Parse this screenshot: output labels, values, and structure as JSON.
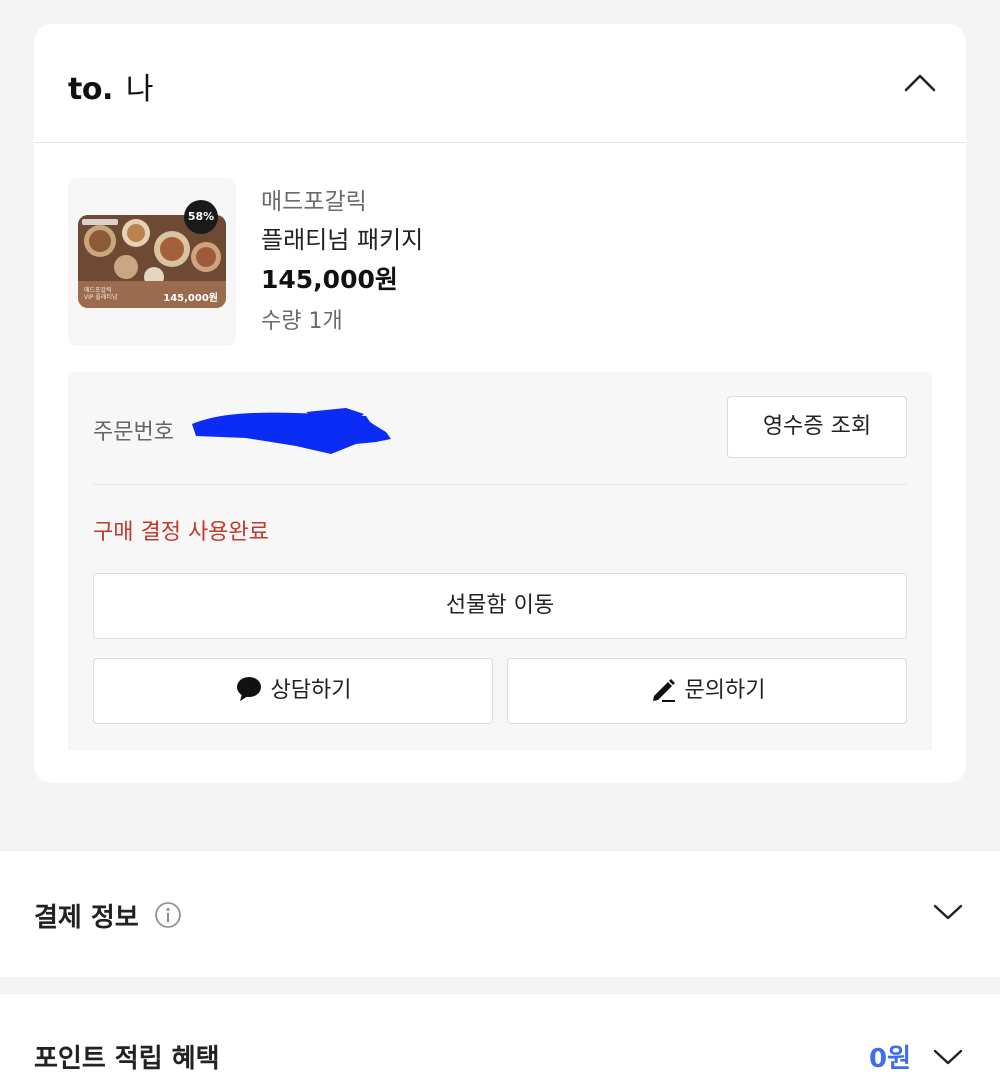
{
  "recipient": {
    "prefix": "to.",
    "name": "나"
  },
  "product": {
    "brand": "매드포갈릭",
    "name": "플래티넘 패키지",
    "price": "145,000원",
    "quantity": "수량 1개",
    "thumbnail": {
      "badge_percent": "58%",
      "brand_line1": "매드포갈릭",
      "brand_line2": "VIP 플래티넘",
      "price": "145,000원"
    }
  },
  "order": {
    "number_label": "주문번호",
    "receipt_button": "영수증 조회",
    "status": "구매 결정 사용완료",
    "giftbox_button": "선물함 이동",
    "chat_button": "상담하기",
    "inquiry_button": "문의하기"
  },
  "sections": {
    "payment_title": "결제 정보",
    "points_title": "포인트 적립 혜택",
    "points_value": "0원"
  },
  "colors": {
    "status": "#c0392b",
    "points": "#3d6ef0",
    "redaction": "#0a2cf5"
  },
  "icons": [
    "chevron-up-icon",
    "speech-bubble-icon",
    "pencil-icon",
    "info-icon",
    "chevron-down-icon"
  ]
}
